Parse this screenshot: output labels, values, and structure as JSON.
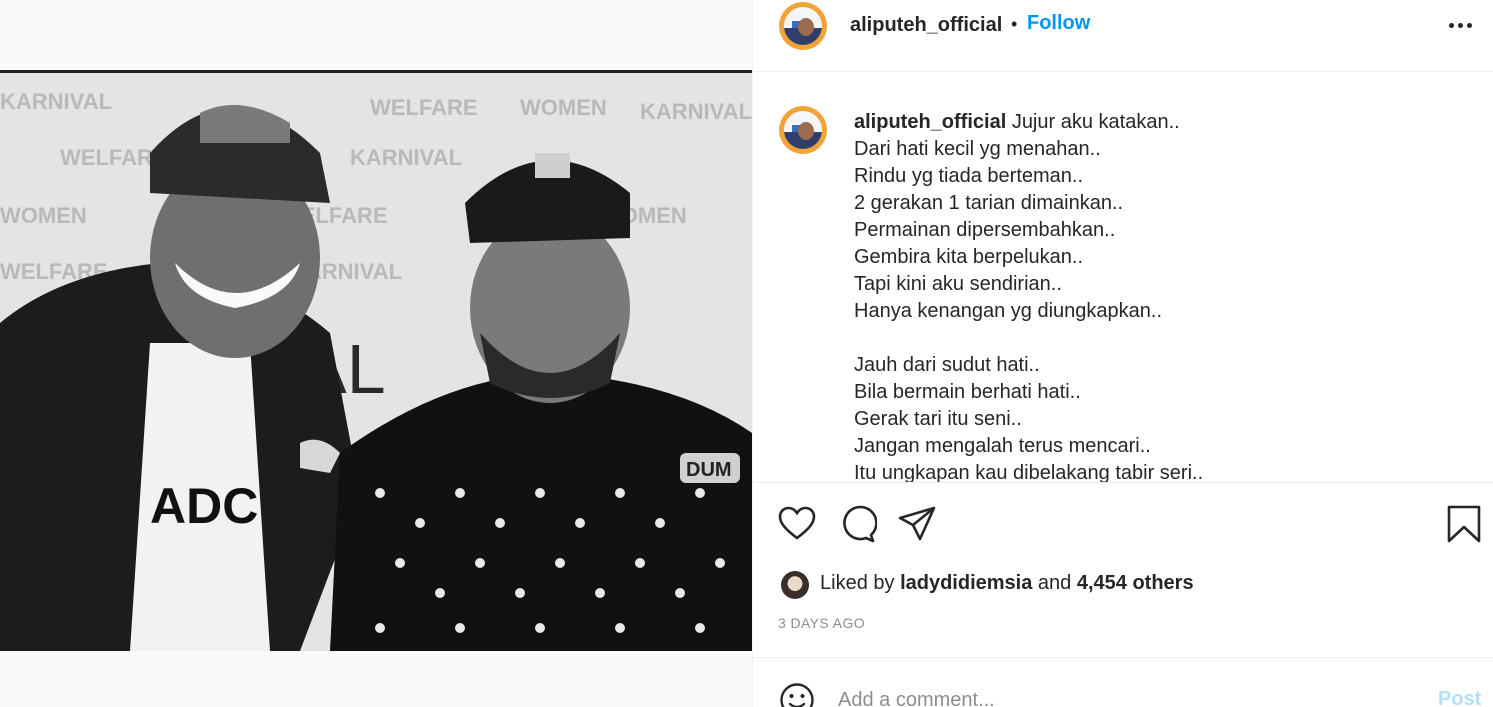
{
  "post": {
    "username": "aliputeh_official",
    "follow_label": "Follow",
    "separator": "•"
  },
  "caption": {
    "username": "aliputeh_official",
    "lines": [
      "Jujur aku katakan..",
      "Dari hati kecil yg menahan..",
      "Rindu yg tiada berteman..",
      "2 gerakan 1 tarian dimainkan..",
      "Permainan dipersembahkan..",
      "Gembira kita berpelukan..",
      "Tapi kini aku sendirian..",
      "Hanya kenangan yg diungkapkan..",
      "",
      "Jauh dari sudut hati..",
      "Bila bermain berhati hati..",
      "Gerak tari itu seni..",
      "Jangan mengalah terus mencari..",
      "Itu ungkapan kau dibelakang tabir seri.."
    ]
  },
  "likes": {
    "prefix": "Liked by",
    "user": "ladydidiemsia",
    "middle": "and",
    "others": "4,454 others"
  },
  "timestamp": "3 DAYS AGO",
  "comment": {
    "placeholder": "Add a comment...",
    "post_label": "Post"
  },
  "photo_texts": {
    "banner_1": "KARNIVAL",
    "banner_2": "WELFARE",
    "banner_3": "WOMEN",
    "shirt": "ADC",
    "cap_badge": "DUM"
  },
  "icons": {
    "more": "more-options-icon",
    "like": "heart-icon",
    "comment": "comment-bubble-icon",
    "share": "paper-plane-icon",
    "save": "bookmark-icon",
    "emoji": "smiley-face-icon"
  },
  "colors": {
    "link": "#0095f6",
    "post_disabled": "#b2dffc",
    "muted": "#8e8e8e",
    "text": "#262626",
    "divider": "#efefef"
  }
}
